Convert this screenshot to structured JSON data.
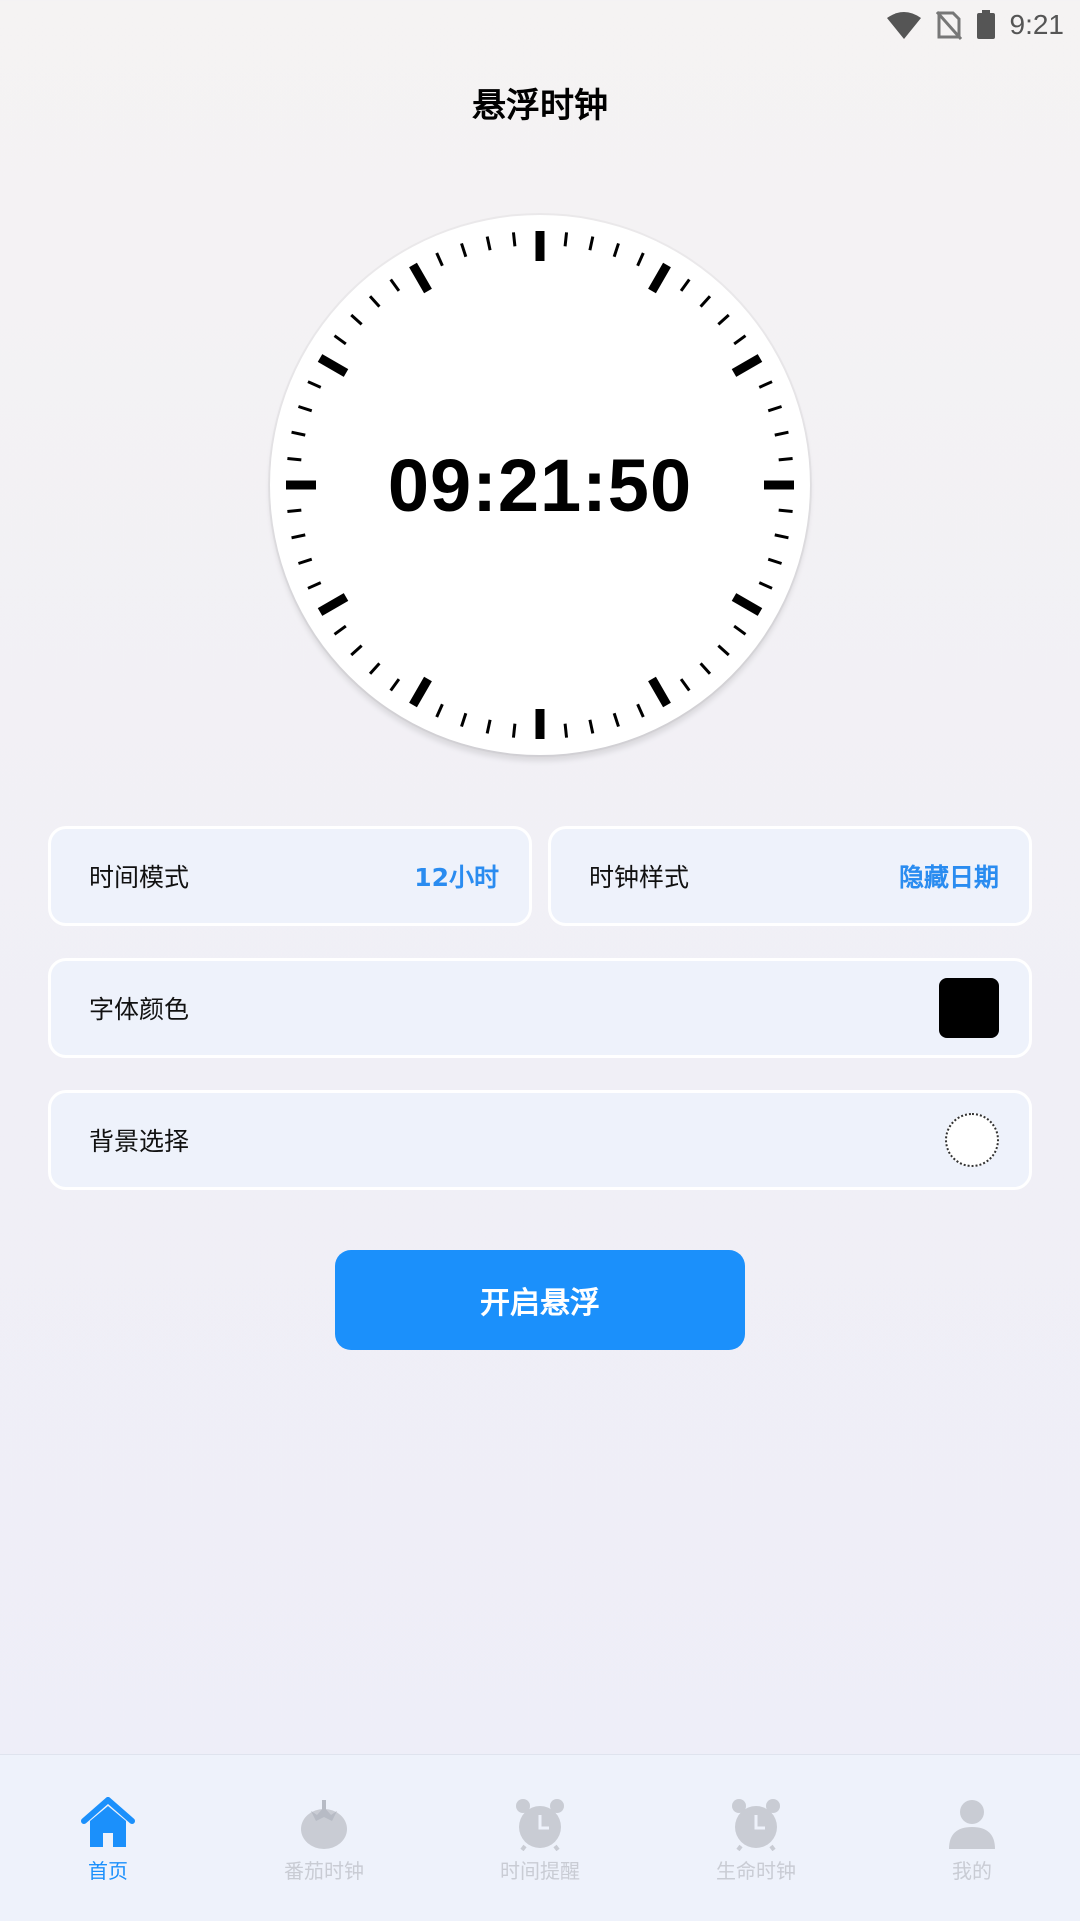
{
  "status_bar": {
    "time": "9:21"
  },
  "header": {
    "title": "悬浮时钟"
  },
  "clock": {
    "time": "09:21:50"
  },
  "settings": {
    "time_mode": {
      "label": "时间模式",
      "value": "12小时"
    },
    "clock_style": {
      "label": "时钟样式",
      "value": "隐藏日期"
    },
    "font_color": {
      "label": "字体颜色",
      "color": "#000000"
    },
    "background": {
      "label": "背景选择",
      "color": "#ffffff"
    }
  },
  "actions": {
    "start_float": "开启悬浮"
  },
  "colors": {
    "accent": "#1b90fb",
    "tab_inactive": "#c9ccd4"
  },
  "tabs": [
    {
      "label": "首页",
      "icon": "home-icon",
      "active": true
    },
    {
      "label": "番茄时钟",
      "icon": "tomato-icon",
      "active": false
    },
    {
      "label": "时间提醒",
      "icon": "alarm-clock-icon",
      "active": false
    },
    {
      "label": "生命时钟",
      "icon": "alarm-clock-icon",
      "active": false
    },
    {
      "label": "我的",
      "icon": "user-icon",
      "active": false
    }
  ]
}
